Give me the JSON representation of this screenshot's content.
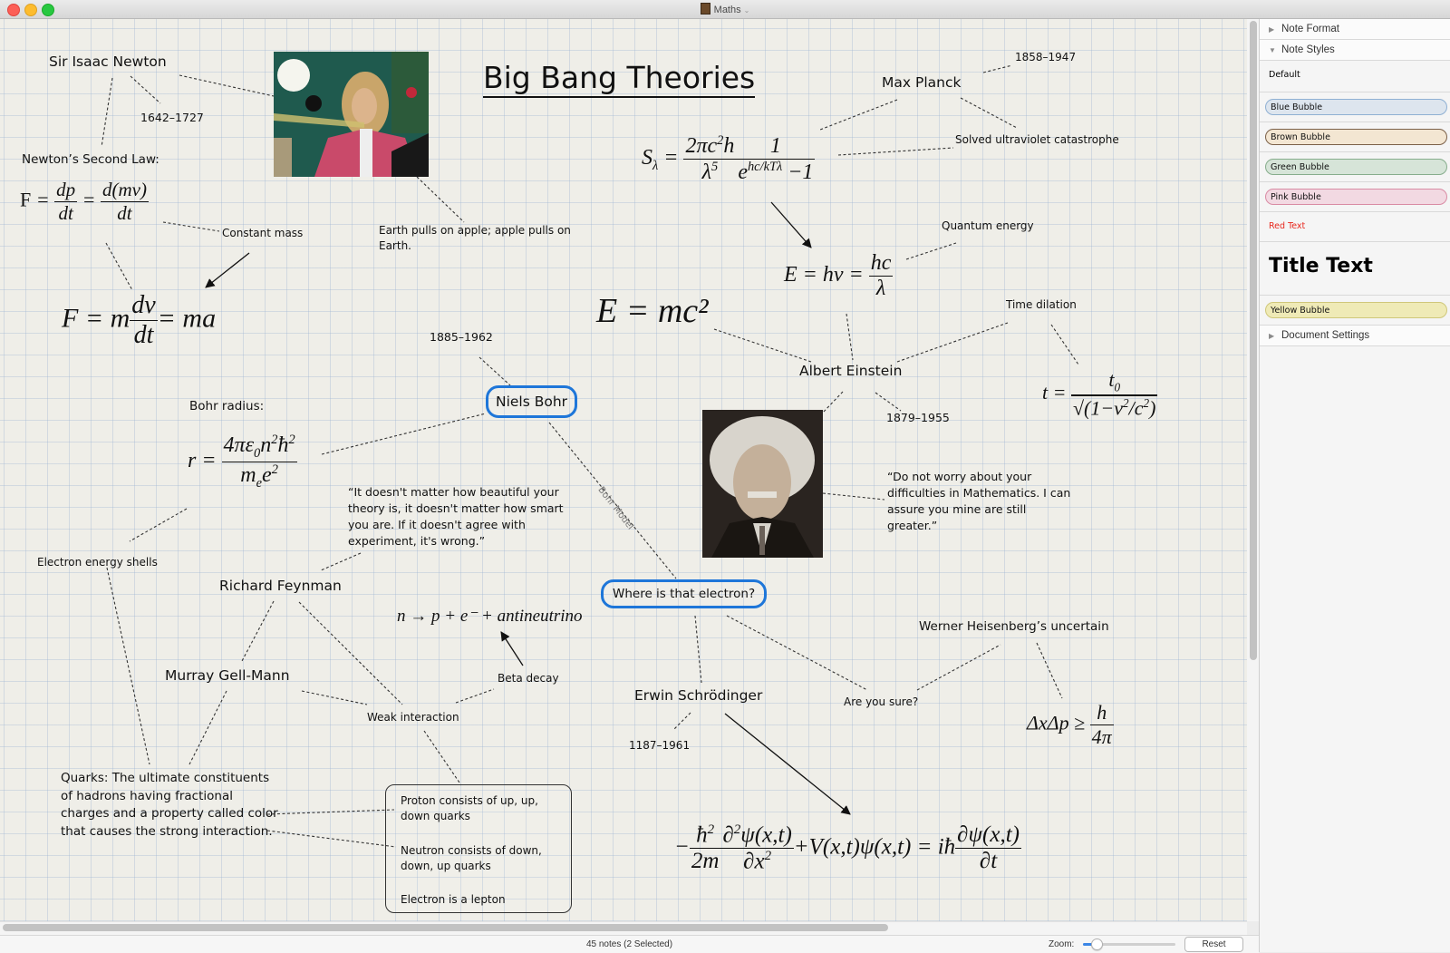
{
  "window": {
    "title": "Maths",
    "controls": [
      "close",
      "minimize",
      "zoom"
    ]
  },
  "canvas": {
    "doc_title": "Big Bang Theories",
    "notes": {
      "newton": "Sir Isaac Newton",
      "newton_dates": "1642–1727",
      "newton_second_law": "Newton’s Second Law:",
      "constant_mass": "Constant mass",
      "earth_apple": "Earth pulls on apple; apple pulls on Earth.",
      "planck": "Max Planck",
      "planck_dates": "1858–1947",
      "ultraviolet": "Solved ultraviolet catastrophe",
      "quantum_energy": "Quantum energy",
      "time_dilation": "Time dilation",
      "einstein": "Albert Einstein",
      "einstein_dates": "1879–1955",
      "einstein_quote": "“Do not worry about your difficulties in Mathematics. I can assure you mine are still greater.”",
      "bohr_dates": "1885–1962",
      "bohr": "Niels Bohr",
      "bohr_radius": "Bohr radius:",
      "feynman_quote": "“It doesn't matter how beautiful your theory is, it doesn't matter how smart you are. If it doesn't agree with experiment, it's wrong.”",
      "electron_shells": "Electron energy shells",
      "feynman": "Richard Feynman",
      "gell_mann": "Murray Gell-Mann",
      "beta_decay": "Beta decay",
      "weak_interaction": "Weak interaction",
      "where_electron": "Where is that electron?",
      "bohr_model_link": "Bohr Model",
      "heisenberg": "Werner Heisenberg’s uncertain",
      "are_you_sure": "Are you sure?",
      "schrodinger": "Erwin Schrödinger",
      "schrodinger_dates": "1187–1961",
      "quarks": "Quarks: The ultimate constituents of hadrons having fractional charges and a property called color that causes the strong interaction.",
      "proton": "Proton consists of up, up, down quarks",
      "neutron": "Neutron consists of down, down, up quarks",
      "electron_lepton": "Electron is a lepton"
    },
    "equations": {
      "beta_decay_eq": "n → p + e⁻ + antineutrino",
      "mass_energy": "E = mc²",
      "heisenberg_eq": "ΔxΔp ≥ h / 4π"
    },
    "images": {
      "newton_photo": "Portrait of Isaac Newton with prism and apple",
      "einstein_photo": "Black and white portrait of Albert Einstein"
    }
  },
  "sidebar": {
    "sections": [
      {
        "label": "Note Format",
        "expanded": false
      },
      {
        "label": "Note Styles",
        "expanded": true
      },
      {
        "label": "Document Settings",
        "expanded": false
      }
    ],
    "styles": [
      {
        "label": "Default"
      },
      {
        "label": "Blue Bubble",
        "fill": "#dde5ee",
        "stroke": "#8fb0d3"
      },
      {
        "label": "Brown Bubble",
        "fill": "#f3e6d2",
        "stroke": "#7b6048"
      },
      {
        "label": "Green Bubble",
        "fill": "#d6e4d8",
        "stroke": "#86ad8c"
      },
      {
        "label": "Pink Bubble",
        "fill": "#f2d9e2",
        "stroke": "#d98ba4"
      },
      {
        "label": "Red Text",
        "color": "#e8281e"
      },
      {
        "label": "Title Text"
      },
      {
        "label": "Yellow Bubble",
        "fill": "#efeab6",
        "stroke": "#cfc77a"
      }
    ]
  },
  "statusbar": {
    "count": "45 notes (2 Selected)",
    "zoom_label": "Zoom:",
    "zoom_level": 0.15,
    "reset_label": "Reset"
  }
}
